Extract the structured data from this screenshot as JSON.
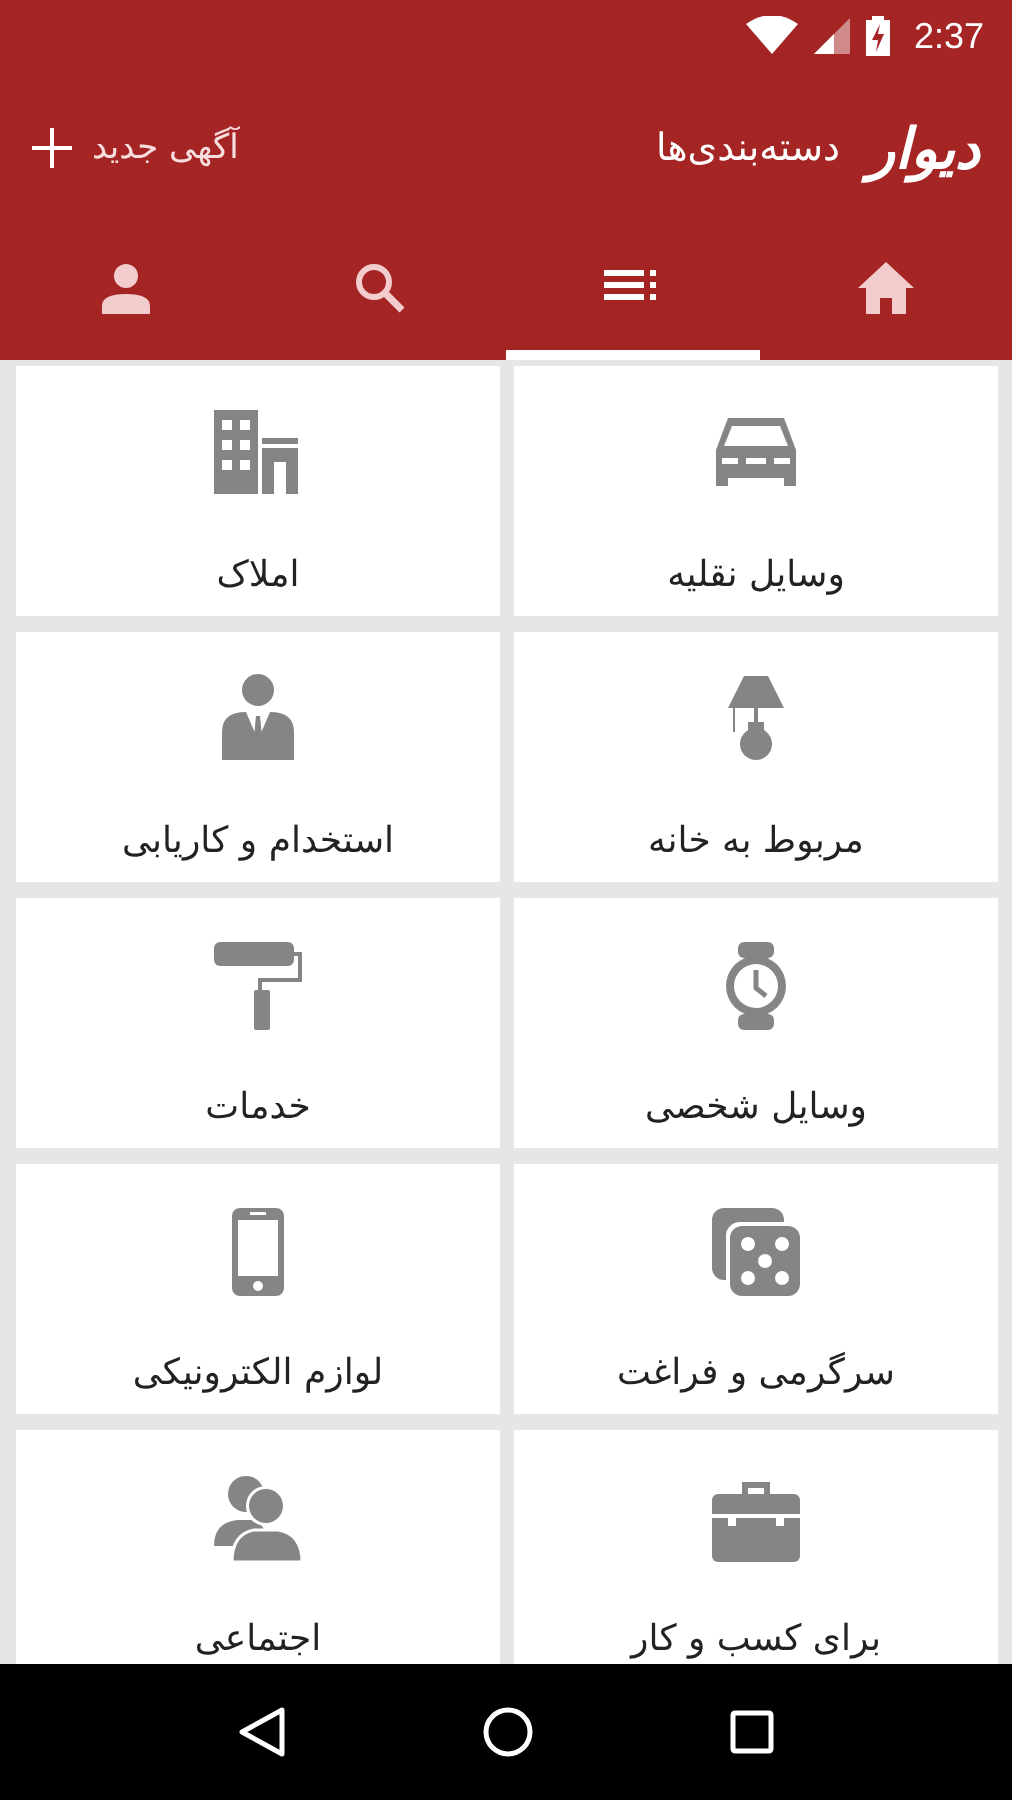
{
  "status_bar": {
    "time": "2:37"
  },
  "toolbar": {
    "logo": "دیوار",
    "title": "دسته‌بندی‌ها",
    "action": "آگهی جدید"
  },
  "tabs": [
    {
      "kind": "home",
      "selected": false
    },
    {
      "kind": "categories",
      "selected": true
    },
    {
      "kind": "search",
      "selected": false
    },
    {
      "kind": "profile",
      "selected": false
    }
  ],
  "categories": [
    {
      "label": "وسایل نقلیه",
      "kind": "car"
    },
    {
      "label": "املاک",
      "kind": "building"
    },
    {
      "label": "مربوط به خانه",
      "kind": "lamp"
    },
    {
      "label": "استخدام و کاریابی",
      "kind": "employee"
    },
    {
      "label": "وسایل شخصی",
      "kind": "watch"
    },
    {
      "label": "خدمات",
      "kind": "roller"
    },
    {
      "label": "سرگرمی و فراغت",
      "kind": "dice"
    },
    {
      "label": "لوازم الکترونیکی",
      "kind": "phone"
    },
    {
      "label": "برای کسب و کار",
      "kind": "briefcase"
    },
    {
      "label": "اجتماعی",
      "kind": "people"
    }
  ]
}
